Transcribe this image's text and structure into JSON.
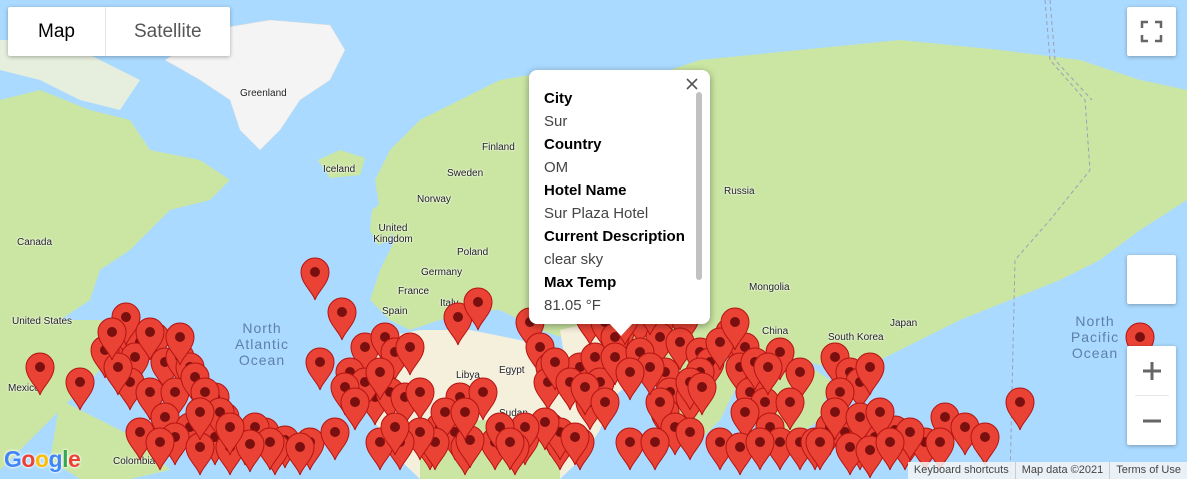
{
  "map_type": {
    "options": [
      "Map",
      "Satellite"
    ],
    "selected": "Map"
  },
  "info_window": {
    "fields": [
      {
        "label": "City",
        "value": "Sur"
      },
      {
        "label": "Country",
        "value": "OM"
      },
      {
        "label": "Hotel Name",
        "value": "Sur Plaza Hotel"
      },
      {
        "label": "Current Description",
        "value": "clear sky"
      },
      {
        "label": "Max Temp",
        "value": "81.05 °F"
      }
    ]
  },
  "place_labels": [
    "Greenland",
    "Iceland",
    "Finland",
    "Sweden",
    "Norway",
    "United Kingdom",
    "Germany",
    "Poland",
    "France",
    "Spain",
    "Italy",
    "Russia",
    "Canada",
    "United States",
    "Mexico",
    "Mongolia",
    "China",
    "Japan",
    "South Korea",
    "Libya",
    "Egypt",
    "Sudan",
    "Colombia"
  ],
  "ocean_labels": [
    "North Atlantic Ocean",
    "North Pacific Ocean"
  ],
  "footer": {
    "shortcuts": "Keyboard shortcuts",
    "map_data": "Map data ©2021",
    "terms": "Terms of Use"
  },
  "logo": "Google",
  "colors": {
    "water": "#aadaff",
    "land": "#cbe6a3",
    "desert": "#f5f0dc",
    "marker": "#ea4335",
    "marker_dot": "#7a0f0f"
  },
  "marker_count_visible": 220
}
